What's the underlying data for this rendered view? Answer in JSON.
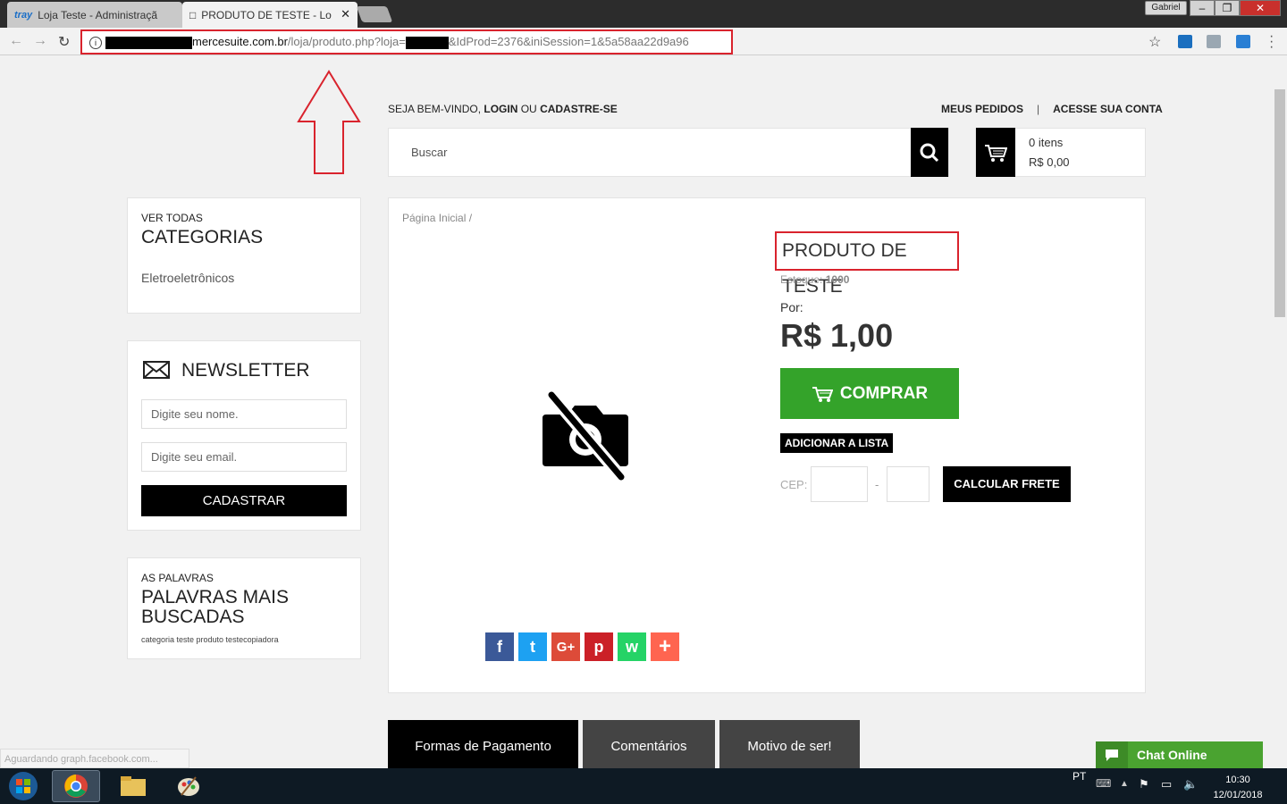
{
  "browser": {
    "tabs": [
      {
        "icon": "tray",
        "label": "Loja Teste - Administraçã"
      },
      {
        "icon": "page-icon",
        "label": "PRODUTO DE TESTE - Lo"
      }
    ],
    "user_badge": "Gabriel",
    "url": {
      "host_suffix": "mercesuite.com.br",
      "path_1": "/loja/produto.php?loja=",
      "path_2": "&IdProd=2376&iniSession=1&5a58aa22d9a96"
    },
    "status_text": "Aguardando graph.facebook.com..."
  },
  "header": {
    "welcome_prefix": "SEJA BEM-VINDO,",
    "login": "LOGIN",
    "or": "OU",
    "signup": "CADASTRE-SE",
    "links": [
      "MEUS PEDIDOS",
      "|",
      "ACESSE SUA CONTA"
    ]
  },
  "search": {
    "placeholder": "Buscar"
  },
  "cart": {
    "items": "0 itens",
    "total": "R$ 0,00"
  },
  "sidebar": {
    "categories": {
      "kicker": "VER TODAS",
      "title": "CATEGORIAS",
      "items": [
        "Eletroeletrônicos"
      ]
    },
    "newsletter": {
      "title": "NEWSLETTER",
      "name_placeholder": "Digite seu nome.",
      "email_placeholder": "Digite seu email.",
      "button": "CADASTRAR"
    },
    "words": {
      "kicker": "AS PALAVRAS",
      "title_1": "PALAVRAS MAIS",
      "title_2": "BUSCADAS",
      "text": "categoria teste produto testecopiadora"
    }
  },
  "product": {
    "breadcrumb": "Página Inicial /",
    "title": "PRODUTO DE TESTE",
    "stock_label": "Estoque:",
    "stock_value": "1000",
    "price_label": "Por:",
    "price": "R$ 1,00",
    "buy": "COMPRAR",
    "add_list": "ADICIONAR A LISTA",
    "cep_label": "CEP:",
    "cep_dash": "-",
    "shipping": "CALCULAR FRETE",
    "share": [
      "f",
      "t",
      "G+",
      "p",
      "w",
      "+"
    ]
  },
  "product_tabs": [
    "Formas de Pagamento",
    "Comentários",
    "Motivo de ser!"
  ],
  "chat": {
    "label": "Chat Online"
  },
  "taskbar": {
    "lang": "PT",
    "time": "10:30",
    "date": "12/01/2018"
  },
  "colors": {
    "accent_red": "#d9232d",
    "buy_green": "#34a32a",
    "chat_green": "#4aa330"
  }
}
